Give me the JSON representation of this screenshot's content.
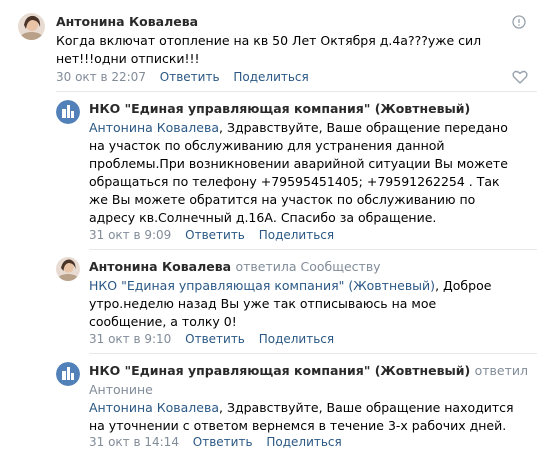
{
  "comments": [
    {
      "author": "Антонина Ковалева",
      "text": "Когда включат отопление на кв 50 Лет Октября д.4а???уже сил нет!!!одни отписки!!!",
      "date": "30 окт в 22:07",
      "reply_label": "Ответить",
      "share_label": "Поделиться"
    },
    {
      "author": "НКО \"Единая управляющая компания\" (Жовтневый)",
      "mention": "Антонина Ковалева",
      "text": ", Здравствуйте, Ваше обращение передано на участок по обслуживанию для устранения данной проблемы.При возникновении аварийной ситуации Вы можете обращаться по телефону +79595451405; +79591262254 . Так же Вы можете обратится на участок по обслуживанию по адресу кв.Солнечный д.16А. Спасибо за обращение.",
      "date": "31 окт в 9:09",
      "reply_label": "Ответить",
      "share_label": "Поделиться"
    },
    {
      "author": "Антонина Ковалева",
      "author_suffix": "ответила Сообществу",
      "mention": "НКО \"Единая управляющая компания\" (Жовтневый)",
      "text": ", Доброе утро.неделю назад Вы уже так отписываюсь на мое сообщение, а толку 0!",
      "date": "31 окт в 9:10",
      "reply_label": "Ответить",
      "share_label": "Поделиться"
    },
    {
      "author": "НКО \"Единая управляющая компания\" (Жовтневый)",
      "author_suffix": "ответил",
      "reply_to": "Антонине",
      "mention": "Антонина Ковалева",
      "text": ", Здравствуйте, Ваше обращение находится на уточнении с ответом вернемся в течение 3-х рабочих дней.",
      "date": "31 окт в 14:14",
      "reply_label": "Ответить",
      "share_label": "Поделиться"
    }
  ],
  "icons": {
    "more": "more-vertical-icon",
    "like": "heart-outline-icon"
  },
  "colors": {
    "link": "#2a5885",
    "meta": "#818c99",
    "divider": "#e7e8ec",
    "org_logo": "#5181b8"
  }
}
